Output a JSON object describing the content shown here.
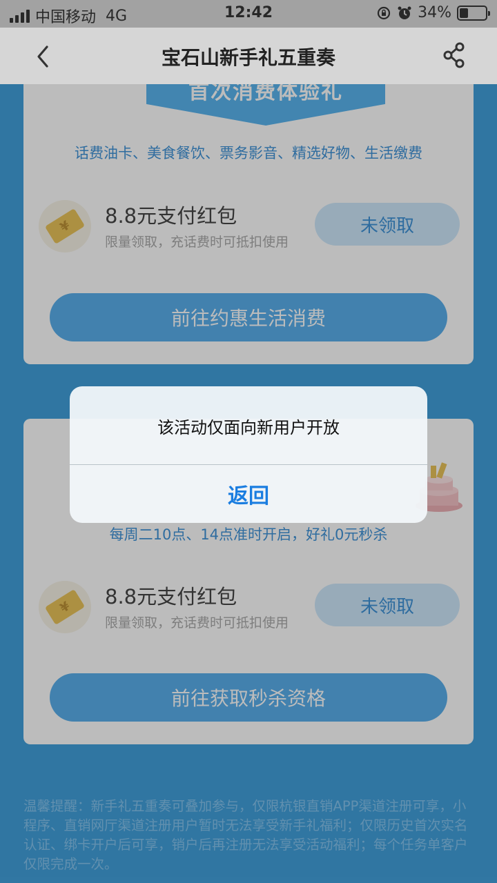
{
  "status_bar": {
    "carrier": "中国移动",
    "network": "4G",
    "time": "12:42",
    "battery": "34%",
    "battery_level": 0.34
  },
  "nav": {
    "title": "宝石山新手礼五重奏",
    "back_icon": "chevron-left-icon",
    "share_icon": "share-icon"
  },
  "card1": {
    "ribbon": "首次消费体验礼",
    "subtitle": "话费油卡、美食餐饮、票务影音、精选好物、生活缴费",
    "reward_name": "8.8元支付红包",
    "reward_desc": "限量领取，充话费时可抵扣使用",
    "claim_label": "未领取",
    "go_label": "前往约惠生活消费"
  },
  "card2": {
    "subtitle": "每周二10点、14点准时开启，好礼0元秒杀",
    "reward_name": "8.8元支付红包",
    "reward_desc": "限量领取，充话费时可抵扣使用",
    "claim_label": "未领取",
    "go_label": "前往获取秒杀资格"
  },
  "tips": "温馨提醒：新手礼五重奏可叠加参与，仅限杭银直销APP渠道注册可享，小程序、直销网厅渠道注册用户暂时无法享受新手礼福利；仅限历史首次实名认证、绑卡开户后可享，销户后再注册无法享受活动福利；每个任务单客户仅限完成一次。",
  "alert": {
    "message": "该活动仅面向新用户开放",
    "button": "返回"
  },
  "colors": {
    "page_bg": "#1e8fd6",
    "accent": "#1a7de0",
    "button_bg": "#3aa1e8"
  }
}
